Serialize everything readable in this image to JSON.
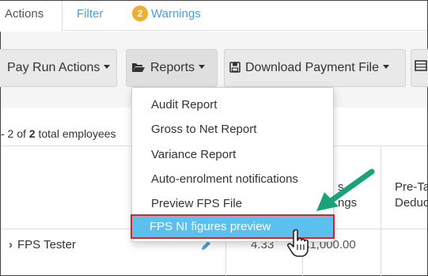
{
  "tabs": {
    "actions": "Actions",
    "filter": "Filter",
    "warnings_count": "2",
    "warnings": "Warnings"
  },
  "toolbar": {
    "pay_run_actions": "Pay Run Actions",
    "reports": "Reports",
    "download_payment_file": "Download Payment File"
  },
  "summary": {
    "prefix": "- 2 of ",
    "count": "2",
    "suffix": " total employees"
  },
  "table": {
    "col_earnings_partial": "s\nngs",
    "col_pretax_partial": "Pre-Ta\nDeduc",
    "row_name": "FPS Tester",
    "row_hours_partial": "4.33",
    "row_amount_partial": "£1,000.00"
  },
  "menu": {
    "items": [
      "Audit Report",
      "Gross to Net Report",
      "Variance Report",
      "Auto-enrolment notifications",
      "Preview FPS File",
      "FPS NI figures preview"
    ],
    "highlighted_index": 5
  },
  "colors": {
    "accent_blue": "#4a9fd8",
    "highlight": "#5bc0ee",
    "highlight_border": "#d8232a",
    "badge": "#f0ad2e",
    "arrow": "#1aa37a"
  }
}
